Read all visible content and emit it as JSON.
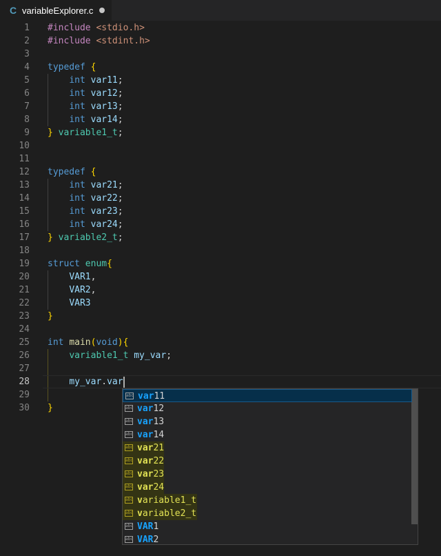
{
  "tab": {
    "language_icon": "C",
    "title": "variableExplorer.c",
    "dirty": true
  },
  "editor": {
    "current_line": 28,
    "lines": [
      {
        "n": "1",
        "tokens": [
          [
            "k-pre",
            "#include "
          ],
          [
            "k-str",
            "<stdio.h>"
          ]
        ]
      },
      {
        "n": "2",
        "tokens": [
          [
            "k-pre",
            "#include "
          ],
          [
            "k-str",
            "<stdint.h>"
          ]
        ]
      },
      {
        "n": "3",
        "tokens": []
      },
      {
        "n": "4",
        "tokens": [
          [
            "k-kw",
            "typedef "
          ],
          [
            "k-br",
            "{"
          ]
        ]
      },
      {
        "n": "5",
        "tokens": [
          [
            "",
            "    "
          ],
          [
            "k-kw",
            "int "
          ],
          [
            "k-var",
            "var11"
          ],
          [
            "",
            ";"
          ]
        ]
      },
      {
        "n": "6",
        "tokens": [
          [
            "",
            "    "
          ],
          [
            "k-kw",
            "int "
          ],
          [
            "k-var",
            "var12"
          ],
          [
            "",
            ";"
          ]
        ]
      },
      {
        "n": "7",
        "tokens": [
          [
            "",
            "    "
          ],
          [
            "k-kw",
            "int "
          ],
          [
            "k-var",
            "var13"
          ],
          [
            "",
            ";"
          ]
        ]
      },
      {
        "n": "8",
        "tokens": [
          [
            "",
            "    "
          ],
          [
            "k-kw",
            "int "
          ],
          [
            "k-var",
            "var14"
          ],
          [
            "",
            ";"
          ]
        ]
      },
      {
        "n": "9",
        "tokens": [
          [
            "k-br",
            "} "
          ],
          [
            "k-ty",
            "variable1_t"
          ],
          [
            "",
            ";"
          ]
        ]
      },
      {
        "n": "10",
        "tokens": []
      },
      {
        "n": "11",
        "tokens": []
      },
      {
        "n": "12",
        "tokens": [
          [
            "k-kw",
            "typedef "
          ],
          [
            "k-br",
            "{"
          ]
        ]
      },
      {
        "n": "13",
        "tokens": [
          [
            "",
            "    "
          ],
          [
            "k-kw",
            "int "
          ],
          [
            "k-var",
            "var21"
          ],
          [
            "",
            ";"
          ]
        ]
      },
      {
        "n": "14",
        "tokens": [
          [
            "",
            "    "
          ],
          [
            "k-kw",
            "int "
          ],
          [
            "k-var",
            "var22"
          ],
          [
            "",
            ";"
          ]
        ]
      },
      {
        "n": "15",
        "tokens": [
          [
            "",
            "    "
          ],
          [
            "k-kw",
            "int "
          ],
          [
            "k-var",
            "var23"
          ],
          [
            "",
            ";"
          ]
        ]
      },
      {
        "n": "16",
        "tokens": [
          [
            "",
            "    "
          ],
          [
            "k-kw",
            "int "
          ],
          [
            "k-var",
            "var24"
          ],
          [
            "",
            ";"
          ]
        ]
      },
      {
        "n": "17",
        "tokens": [
          [
            "k-br",
            "} "
          ],
          [
            "k-ty",
            "variable2_t"
          ],
          [
            "",
            ";"
          ]
        ]
      },
      {
        "n": "18",
        "tokens": []
      },
      {
        "n": "19",
        "tokens": [
          [
            "k-kw",
            "struct "
          ],
          [
            "k-ty",
            "enum"
          ],
          [
            "k-br",
            "{"
          ]
        ]
      },
      {
        "n": "20",
        "tokens": [
          [
            "",
            "    "
          ],
          [
            "k-var",
            "VAR1"
          ],
          [
            "",
            ","
          ]
        ]
      },
      {
        "n": "21",
        "tokens": [
          [
            "",
            "    "
          ],
          [
            "k-var",
            "VAR2"
          ],
          [
            "",
            ","
          ]
        ]
      },
      {
        "n": "22",
        "tokens": [
          [
            "",
            "    "
          ],
          [
            "k-var",
            "VAR3"
          ]
        ]
      },
      {
        "n": "23",
        "tokens": [
          [
            "k-br",
            "}"
          ]
        ]
      },
      {
        "n": "24",
        "tokens": []
      },
      {
        "n": "25",
        "tokens": [
          [
            "k-kw",
            "int "
          ],
          [
            "k-fn",
            "main"
          ],
          [
            "k-br",
            "("
          ],
          [
            "k-kw",
            "void"
          ],
          [
            "k-br",
            ")"
          ],
          [
            "k-br",
            "{"
          ]
        ]
      },
      {
        "n": "26",
        "tokens": [
          [
            "",
            "    "
          ],
          [
            "k-ty",
            "variable1_t "
          ],
          [
            "k-var",
            "my_var"
          ],
          [
            "",
            ";"
          ]
        ]
      },
      {
        "n": "27",
        "tokens": []
      },
      {
        "n": "28",
        "tokens": [
          [
            "",
            "    "
          ],
          [
            "k-var",
            "my_var"
          ],
          [
            "",
            "."
          ],
          [
            "k-var",
            "var"
          ]
        ]
      },
      {
        "n": "29",
        "tokens": []
      },
      {
        "n": "30",
        "tokens": [
          [
            "k-br",
            "}"
          ]
        ]
      }
    ]
  },
  "suggestions": {
    "icon_name": "abc-text-icon",
    "items": [
      {
        "match": "var",
        "rest": "11",
        "yellow": false
      },
      {
        "match": "var",
        "rest": "12",
        "yellow": false
      },
      {
        "match": "var",
        "rest": "13",
        "yellow": false
      },
      {
        "match": "var",
        "rest": "14",
        "yellow": false
      },
      {
        "match": "var",
        "rest": "21",
        "yellow": true
      },
      {
        "match": "var",
        "rest": "22",
        "yellow": true
      },
      {
        "match": "var",
        "rest": "23",
        "yellow": true
      },
      {
        "match": "var",
        "rest": "24",
        "yellow": true
      },
      {
        "match": "v",
        "rest": "ar",
        "after": "iable1_t",
        "yellow": true,
        "full": "variable1_t"
      },
      {
        "match": "v",
        "rest": "ar",
        "after": "iable2_t",
        "yellow": true,
        "full": "variable2_t"
      },
      {
        "match": "VAR",
        "rest": "1",
        "yellow": false
      },
      {
        "match": "VAR",
        "rest": "2",
        "yellow": false
      }
    ]
  }
}
